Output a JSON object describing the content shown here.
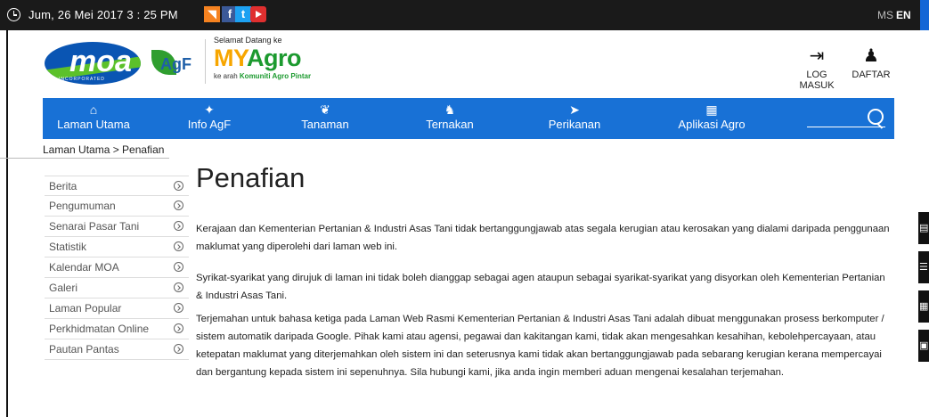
{
  "topbar": {
    "datetime": "Jum, 26 Mei 2017  3 : 25  PM",
    "social": [
      "rss-icon",
      "facebook-icon",
      "twitter-icon",
      "youtube-icon"
    ],
    "lang_ms": "MS",
    "lang_en": "EN"
  },
  "header": {
    "moa_text": "moa",
    "moa_sub": "INCORPORATED",
    "agf_text": "AgF",
    "welcome": "Selamat Datang ke",
    "title_my": "MY",
    "title_agro": "Agro",
    "tag_prefix": "ke arah ",
    "tag_bold": "Komuniti Agro Pintar",
    "login_label": "LOG MASUK",
    "register_label": "DAFTAR"
  },
  "nav": {
    "items": [
      {
        "label": "Laman Utama",
        "icon": "home-icon",
        "glyph": "⌂"
      },
      {
        "label": "Info AgF",
        "icon": "agf-icon",
        "glyph": "✦"
      },
      {
        "label": "Tanaman",
        "icon": "leaf-icon",
        "glyph": "❦"
      },
      {
        "label": "Ternakan",
        "icon": "cow-icon",
        "glyph": "♞"
      },
      {
        "label": "Perikanan",
        "icon": "fish-icon",
        "glyph": "➤"
      },
      {
        "label": "Aplikasi Agro",
        "icon": "apps-icon",
        "glyph": "▦"
      }
    ]
  },
  "breadcrumb": "Laman Utama > Penafian",
  "sidebar": {
    "items": [
      "Berita",
      "Pengumuman",
      "Senarai Pasar Tani",
      "Statistik",
      "Kalendar MOA",
      "Galeri",
      "Laman Popular",
      "Perkhidmatan Online",
      "Pautan Pantas"
    ]
  },
  "main": {
    "title": "Penafian",
    "p1": "Kerajaan dan Kementerian Pertanian & Industri Asas Tani tidak bertanggungjawab atas segala kerugian atau kerosakan yang dialami daripada penggunaan maklumat yang diperolehi dari laman web ini.",
    "p2": "Syrikat-syarikat yang dirujuk di laman ini tidak boleh dianggap sebagai agen ataupun sebagai syarikat-syarikat yang disyorkan oleh Kementerian Pertanian & Industri Asas Tani.",
    "p3": "Terjemahan untuk bahasa ketiga pada Laman Web Rasmi Kementerian Pertanian & Industri Asas Tani adalah dibuat menggunakan prosess berkomputer / sistem automatik daripada Google. Pihak kami atau agensi, pegawai dan kakitangan kami, tidak akan mengesahkan kesahihan, kebolehpercayaan, atau ketepatan maklumat yang diterjemahkan oleh sistem ini dan seterusnya kami tidak akan bertanggungjawab pada sebarang kerugian kerana mempercayai dan bergantung kepada sistem ini sepenuhnya. Sila hubungi kami, jika anda ingin memberi aduan mengenai kesalahan terjemahan."
  },
  "tools": [
    "feedback-icon",
    "sitemap-icon",
    "qr-code-icon",
    "news-icon"
  ]
}
